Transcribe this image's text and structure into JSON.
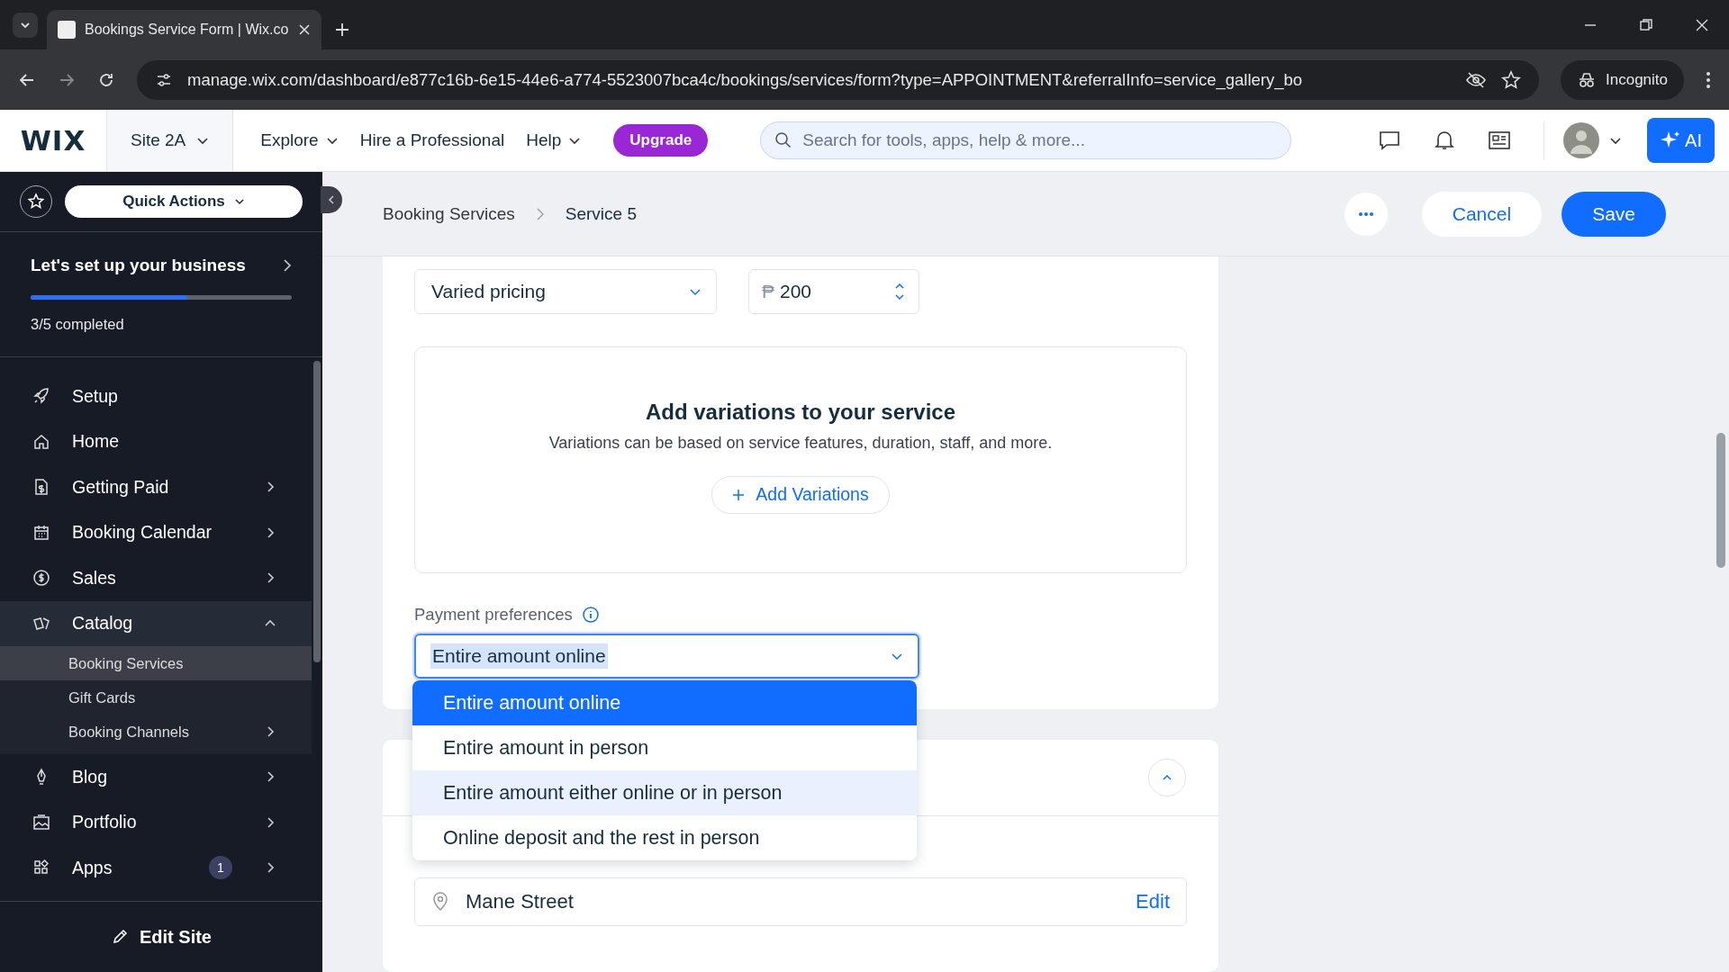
{
  "browser": {
    "tab_title": "Bookings Service Form | Wix.co",
    "url": "manage.wix.com/dashboard/e877c16b-6e15-44e6-a774-5523007bca4c/bookings/services/form?type=APPOINTMENT&referralInfo=service_gallery_bo",
    "incognito_label": "Incognito"
  },
  "topbar": {
    "logo": "WIX",
    "site": "Site 2A",
    "menus": [
      {
        "label": "Explore",
        "caret": true
      },
      {
        "label": "Hire a Professional",
        "caret": false
      },
      {
        "label": "Help",
        "caret": true
      }
    ],
    "upgrade": "Upgrade",
    "search": {
      "placeholder": "Search for tools, apps, help & more..."
    },
    "ai": "AI"
  },
  "sidebar": {
    "quick_actions": "Quick Actions",
    "setup": {
      "title": "Let's set up your business",
      "level": 0.6,
      "progress": "3/5 completed"
    },
    "items": [
      {
        "label": "Setup",
        "submenu": false
      },
      {
        "label": "Home",
        "submenu": false
      },
      {
        "label": "Getting Paid",
        "submenu": true
      },
      {
        "label": "Booking Calendar",
        "submenu": true
      },
      {
        "label": "Sales",
        "submenu": true
      },
      {
        "label": "Catalog",
        "submenu": true,
        "expanded": true,
        "children": [
          {
            "label": "Booking Services",
            "selected": true,
            "submenu": false
          },
          {
            "label": "Gift Cards",
            "selected": false,
            "submenu": false
          },
          {
            "label": "Booking Channels",
            "selected": false,
            "submenu": true
          }
        ]
      },
      {
        "label": "Blog",
        "submenu": true
      },
      {
        "label": "Portfolio",
        "submenu": true
      },
      {
        "label": "Apps",
        "submenu": true,
        "badge": "1"
      }
    ],
    "edit_site": "Edit Site"
  },
  "header": {
    "breadcrumbs": [
      "Booking Services",
      "Service 5"
    ],
    "cancel": "Cancel",
    "save": "Save"
  },
  "form": {
    "price_type": "Varied pricing",
    "price": {
      "currency": "₱",
      "value": "200"
    },
    "variations": {
      "title": "Add variations to your service",
      "subtitle": "Variations can be based on service features, duration, staff, and more.",
      "button": "Add Variations"
    },
    "payment": {
      "label": "Payment preferences",
      "value": "Entire amount online",
      "expanded": true,
      "options": [
        {
          "label": "Entire amount online",
          "selected": true,
          "hovered": false
        },
        {
          "label": "Entire amount in person",
          "selected": false,
          "hovered": false
        },
        {
          "label": "Entire amount either online or in person",
          "selected": false,
          "hovered": true
        },
        {
          "label": "Online deposit and the rest in person",
          "selected": false,
          "hovered": false
        }
      ]
    },
    "location": {
      "value": "Mane Street",
      "edit": "Edit"
    }
  }
}
